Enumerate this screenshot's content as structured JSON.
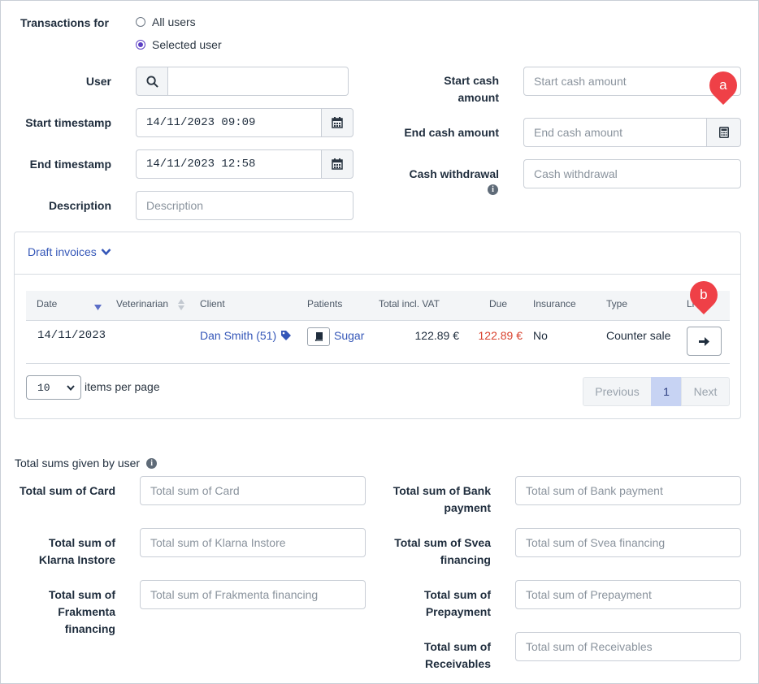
{
  "filters": {
    "transactions_for_label": "Transactions for",
    "radio_all": "All users",
    "radio_selected": "Selected user",
    "user_label": "User",
    "user_value": "",
    "start_ts_label": "Start timestamp",
    "start_ts_value": "14/11/2023 09:09",
    "end_ts_label": "End timestamp",
    "end_ts_value": "14/11/2023 12:58",
    "description_label": "Description",
    "description_placeholder": "Description",
    "start_cash_label_1": "Start cash",
    "start_cash_label_2": "amount",
    "start_cash_placeholder": "Start cash amount",
    "end_cash_label": "End cash amount",
    "end_cash_placeholder": "End cash amount",
    "withdrawal_label": "Cash withdrawal",
    "withdrawal_placeholder": "Cash withdrawal"
  },
  "draft_invoices": {
    "toggle_label": "Draft invoices",
    "columns": [
      "Date",
      "Veterinarian",
      "Client",
      "Patients",
      "Total incl. VAT",
      "Due",
      "Insurance",
      "Type",
      "Li"
    ],
    "rows": [
      {
        "date": "14/11/2023",
        "veterinarian": "",
        "client": "Dan Smith (51)",
        "patient": "Sugar",
        "total": "122.89 €",
        "due": "122.89 €",
        "insurance": "No",
        "type": "Counter sale"
      }
    ],
    "per_page_value": "10",
    "per_page_label": "items per page",
    "prev_label": "Previous",
    "page_label": "1",
    "next_label": "Next"
  },
  "totals": {
    "heading": "Total sums given by user",
    "left": [
      {
        "label": [
          "Total sum of Card"
        ],
        "placeholder": "Total sum of Card"
      },
      {
        "label": [
          "Total sum of",
          "Klarna Instore"
        ],
        "placeholder": "Total sum of Klarna Instore"
      },
      {
        "label": [
          "Total sum of",
          "Frakmenta",
          "financing"
        ],
        "placeholder": "Total sum of Frakmenta financing"
      }
    ],
    "right": [
      {
        "label": [
          "Total sum of Bank",
          "payment"
        ],
        "placeholder": "Total sum of Bank payment"
      },
      {
        "label": [
          "Total sum of Svea",
          "financing"
        ],
        "placeholder": "Total sum of Svea financing"
      },
      {
        "label": [
          "Total sum of",
          "Prepayment"
        ],
        "placeholder": "Total sum of Prepayment"
      },
      {
        "label": [
          "Total sum of",
          "Receivables"
        ],
        "placeholder": "Total sum of Receivables"
      }
    ]
  },
  "markers": {
    "a": "a",
    "b": "b"
  },
  "colors": {
    "accent": "#5b3fc4",
    "link": "#3557b8",
    "due": "#d9432f",
    "pin": "#ef4047",
    "active_page": "#c7d3f3"
  }
}
